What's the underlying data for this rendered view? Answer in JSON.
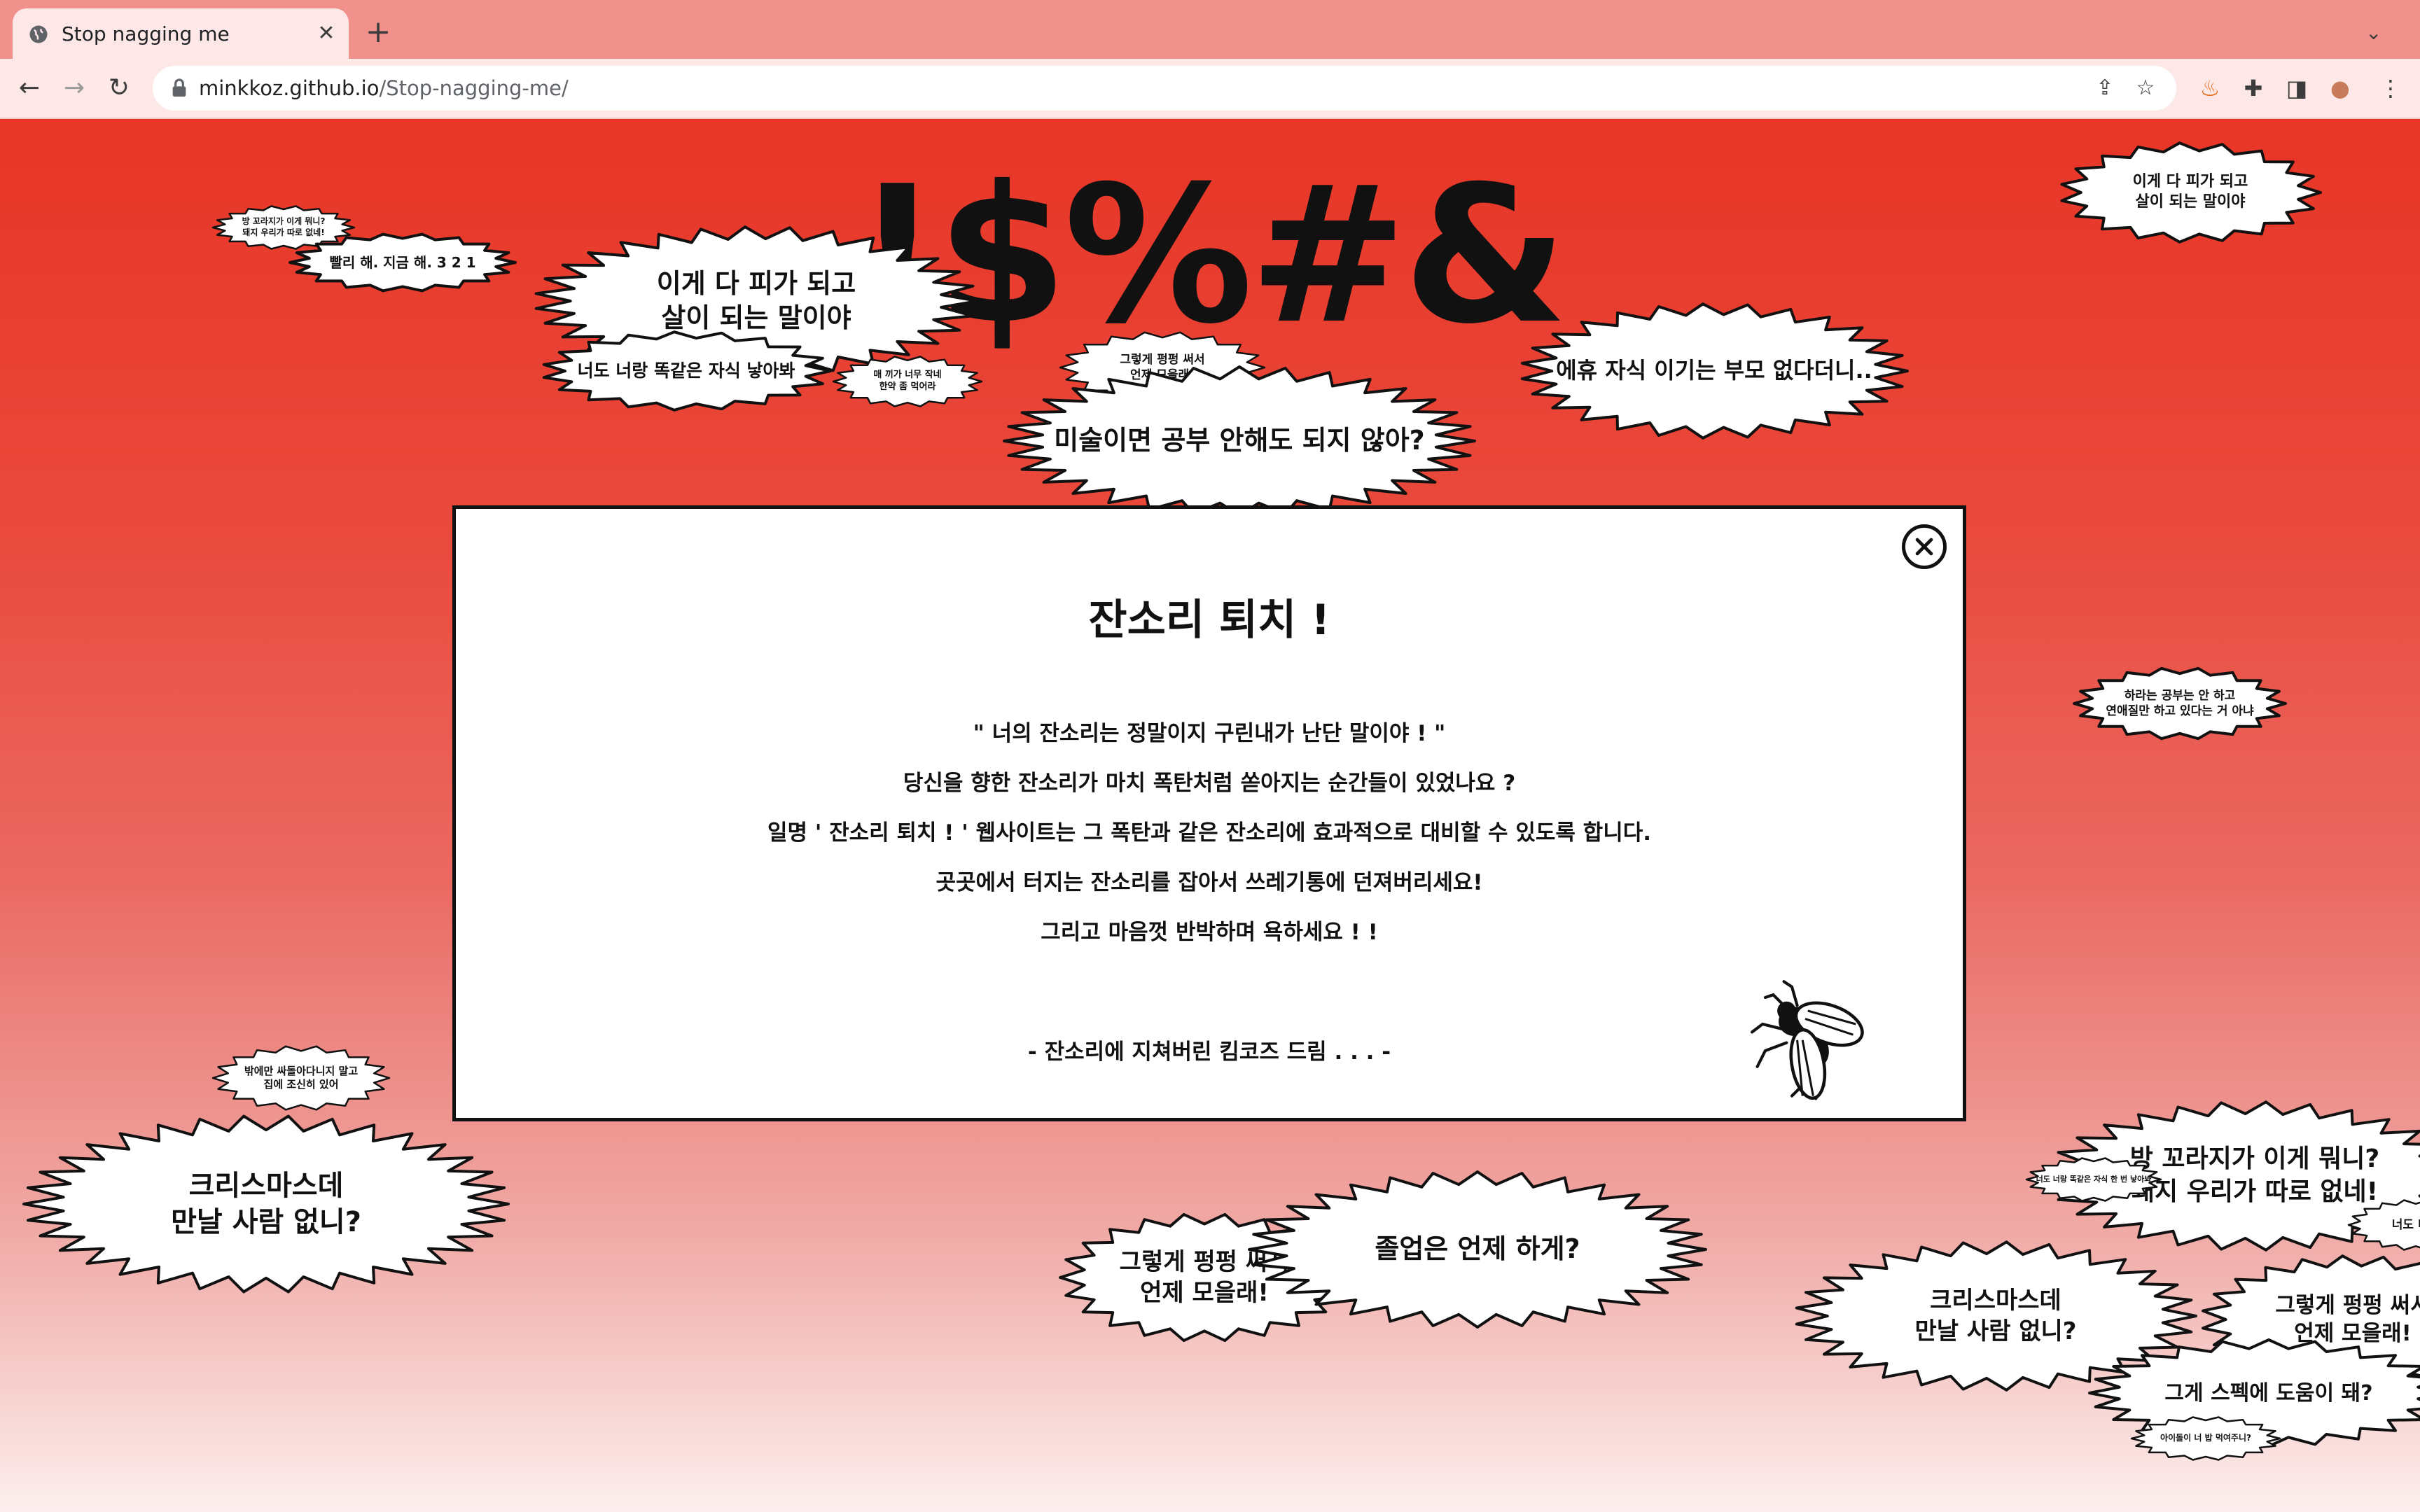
{
  "browser": {
    "tab_title": "Stop nagging me",
    "url_host": "minkkoz.github.io",
    "url_path": "/Stop-nagging-me/"
  },
  "page": {
    "title_glyphs": "!$%#&",
    "bubbles": [
      "방 꼬라지가 이게 뭐니?\n돼지 우리가 따로 없네!",
      "빨리 해. 지금 해. 3 2 1",
      "이게 다 피가 되고\n살이 되는 말이야",
      "너도 너랑 똑같은 자식 낳아봐",
      "매 끼가 너무 작네\n한약 좀 먹어라",
      "그렇게 펑펑 써서\n언제 모을래!",
      "미술이면 공부 안해도 되지 않아?",
      "에휴 자식 이기는 부모 없다더니..",
      "이게 다 피가 되고\n살이 되는 말이야",
      "하라는 공부는 안 하고\n연애질만 하고 있다는 거 아냐",
      "밖에만 싸돌아다니지 말고\n집에 조신히 있어",
      "크리스마스데\n만날 사람 없니?",
      "그렇게 펑펑 써서\n언제 모을래!",
      "졸업은 언제 하게?",
      "방 꼬라지가 이게 뭐니?\n돼지 우리가 따로 없네!",
      "너도 너랑 똑같은 자식 한 번 낳아봐",
      "너도 너랑",
      "크리스마스데\n만날 사람 없니?",
      "그렇게 펑펑 써서\n언제 모을래!",
      "그게 스펙에 도움이 돼?",
      "아이돌이 너 밥 먹여주니?"
    ]
  },
  "modal": {
    "title": "잔소리 퇴치 !",
    "lines": [
      "\" 너의 잔소리는 정말이지 구린내가 난단 말이야 ! \"",
      "당신을 향한 잔소리가 마치 폭탄처럼 쏟아지는 순간들이 있었나요 ?",
      "일명 ' 잔소리 퇴치 ! ' 웹사이트는 그 폭탄과 같은 잔소리에 효과적으로 대비할 수 있도록 합니다.",
      "곳곳에서 터지는 잔소리를 잡아서 쓰레기통에 던져버리세요!",
      "그리고 마음껏 반박하며 욕하세요 ! !"
    ],
    "signature": "- 잔소리에 지쳐버린 킴코즈 드림 . . . -"
  },
  "colors": {
    "page_red": "#e83526",
    "tabbar": "#f1918c",
    "toolbar": "#fde8e7"
  },
  "icons": [
    "globe-icon",
    "close-icon",
    "plus-icon",
    "chevron-down-icon",
    "back-arrow-icon",
    "forward-arrow-icon",
    "reload-icon",
    "lock-icon",
    "share-icon",
    "bookmark-star-icon",
    "fire-extension-icon",
    "puzzle-extensions-icon",
    "sidepanel-icon",
    "profile-avatar-icon",
    "kebab-menu-icon",
    "fly-icon"
  ]
}
